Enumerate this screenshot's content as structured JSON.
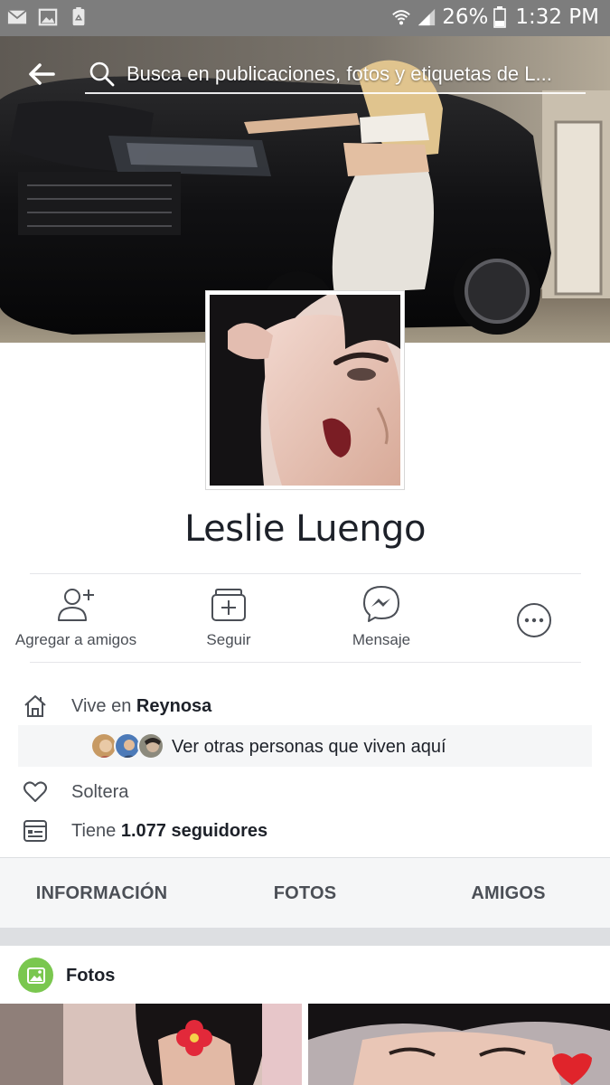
{
  "status_bar": {
    "battery": "26%",
    "time": "1:32 PM",
    "left_icons": [
      "mail-icon",
      "image-icon",
      "recycle-icon"
    ],
    "right_icons": [
      "wifi-icon",
      "signal-icon",
      "battery-icon"
    ]
  },
  "header": {
    "search_placeholder": "Busca en publicaciones, fotos y etiquetas de L..."
  },
  "profile": {
    "name": "Leslie Luengo"
  },
  "actions": [
    {
      "label": "Agregar a amigos",
      "icon": "add-friend-icon"
    },
    {
      "label": "Seguir",
      "icon": "follow-icon"
    },
    {
      "label": "Mensaje",
      "icon": "messenger-icon"
    },
    {
      "label": "",
      "icon": "more-icon"
    }
  ],
  "info": {
    "lives_prefix": "Vive en ",
    "lives_city": "Reynosa",
    "others_text": "Ver otras personas que viven aquí",
    "relationship": "Soltera",
    "followers_prefix": "Tiene ",
    "followers_value": "1.077 seguidores"
  },
  "tabs": [
    "INFORMACIÓN",
    "FOTOS",
    "AMIGOS"
  ],
  "photos_section": {
    "title": "Fotos"
  },
  "colors": {
    "status_bar": "#7d7d7d",
    "text_primary": "#1d2129",
    "text_secondary": "#4b4f56",
    "tab_background": "#f5f6f7",
    "photos_icon": "#7ac74f"
  }
}
